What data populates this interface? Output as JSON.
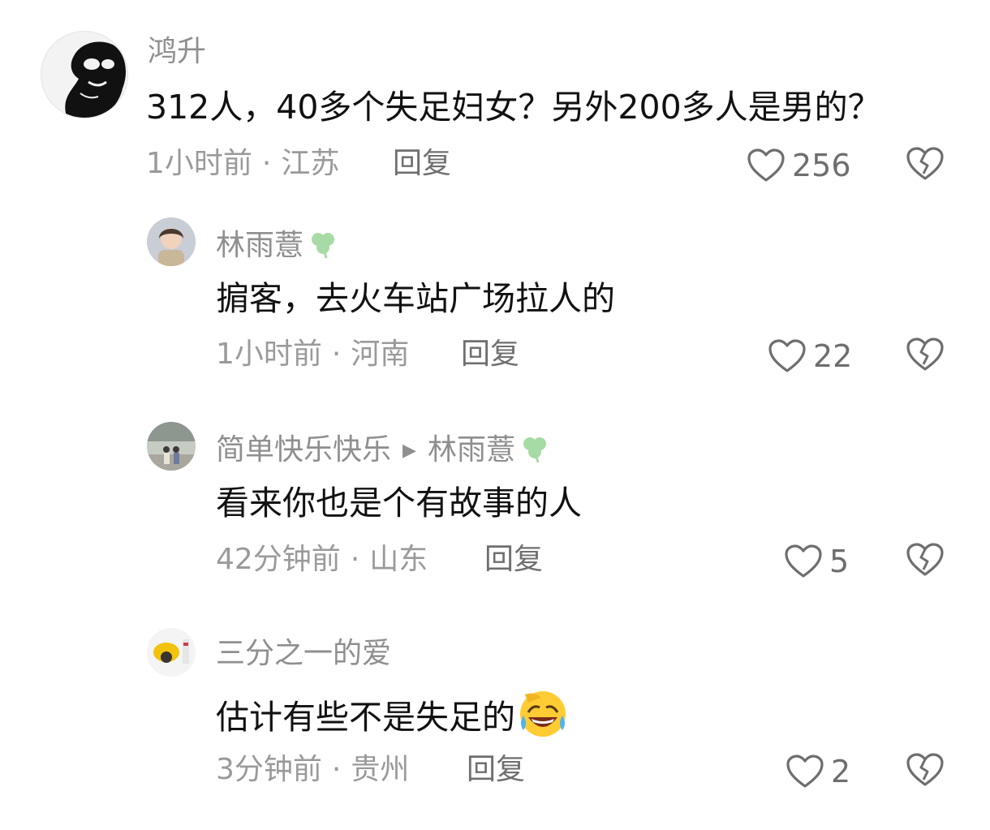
{
  "comments": [
    {
      "author": "鸿升",
      "text": "312人，40多个失足妇女？另外200多人是男的？",
      "time": "1小时前",
      "location": "江苏",
      "reply_label": "回复",
      "likes": "256",
      "avatar_icon": "silhouette-avatar"
    },
    {
      "author": "林雨薏",
      "author_badge_icon": "clover-icon",
      "text": "掮客，去火车站广场拉人的",
      "time": "1小时前",
      "location": "河南",
      "reply_label": "回复",
      "likes": "22",
      "avatar_icon": "child-photo-avatar"
    },
    {
      "author": "简单快乐快乐",
      "reply_to": "林雨薏",
      "text": "看来你也是个有故事的人",
      "time": "42分钟前",
      "location": "山东",
      "reply_label": "回复",
      "likes": "5",
      "avatar_icon": "people-photo-avatar"
    },
    {
      "author": "三分之一的爱",
      "text": "估计有些不是失足的",
      "text_emoji_icon": "laughing-crying-emoji",
      "time": "3分钟前",
      "location": "贵州",
      "reply_label": "回复",
      "likes": "2",
      "avatar_icon": "yellow-hat-avatar"
    }
  ],
  "meta_separator": "·",
  "colors": {
    "name": "#8f8f8f",
    "text": "#111111",
    "meta": "#9a9a9a",
    "icon": "#6e6e6e"
  }
}
